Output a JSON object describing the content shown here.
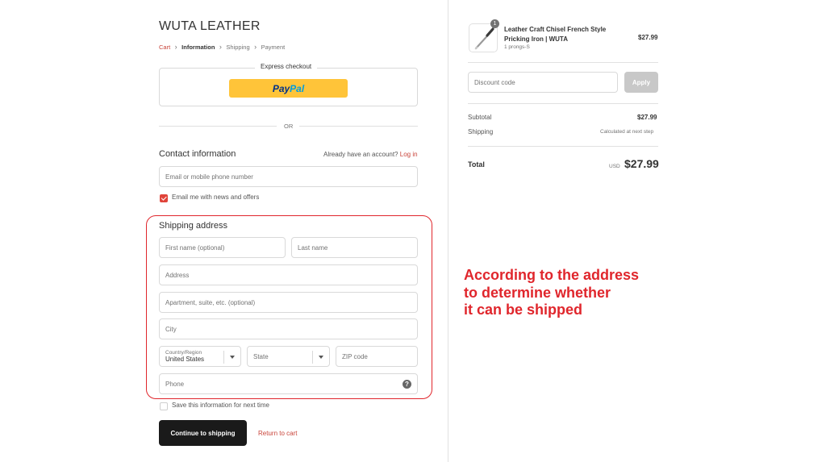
{
  "store": {
    "name": "WUTA LEATHER"
  },
  "breadcrumb": [
    {
      "label": "Cart",
      "state": "link"
    },
    {
      "label": "Information",
      "state": "current"
    },
    {
      "label": "Shipping",
      "state": "upcoming"
    },
    {
      "label": "Payment",
      "state": "upcoming"
    }
  ],
  "express": {
    "label": "Express checkout",
    "paypal_pay": "Pay",
    "paypal_pal": "Pal"
  },
  "divider_or": "OR",
  "contact": {
    "title": "Contact information",
    "have_account": "Already have an account?",
    "login": "Log in",
    "email_placeholder": "Email or mobile phone number",
    "news_label": "Email me with news and offers",
    "news_checked": true
  },
  "shipping": {
    "title": "Shipping address",
    "first_name_placeholder": "First name (optional)",
    "last_name_placeholder": "Last name",
    "address_placeholder": "Address",
    "apt_placeholder": "Apartment, suite, etc. (optional)",
    "city_placeholder": "City",
    "country_label": "Country/Region",
    "country_value": "United States",
    "state_placeholder": "State",
    "zip_placeholder": "ZIP code",
    "phone_placeholder": "Phone",
    "help_icon": "?",
    "save_label": "Save this information for next time",
    "save_checked": false
  },
  "actions": {
    "continue": "Continue to shipping",
    "return": "Return to cart"
  },
  "summary": {
    "product": {
      "title": "Leather Craft Chisel French Style Pricking Iron | WUTA",
      "variant": "1 prongs-S",
      "price": "$27.99",
      "quantity": "1",
      "icon": "chisel-icon"
    },
    "discount_placeholder": "Discount code",
    "apply": "Apply",
    "subtotal_label": "Subtotal",
    "subtotal_value": "$27.99",
    "shipping_label": "Shipping",
    "shipping_value": "Calculated at next step",
    "total_label": "Total",
    "currency": "USD",
    "total_value": "$27.99"
  },
  "annotation": {
    "lines": [
      "According to the address",
      "to determine whether",
      "it can be shipped"
    ],
    "color": "#e0262c"
  },
  "colors": {
    "accent": "#c9443a",
    "checkbox": "#e0443a",
    "paypal_yellow": "#ffc439",
    "button_dark": "#1a1a1a",
    "highlight": "#e0262c"
  }
}
